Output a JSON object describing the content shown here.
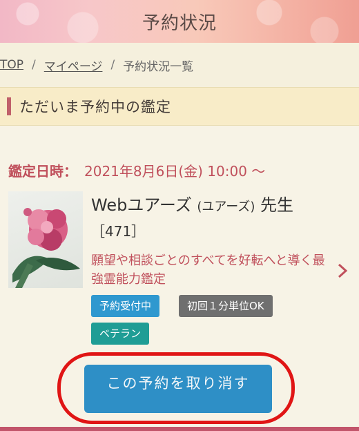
{
  "header": {
    "title": "予約状況"
  },
  "breadcrumb": {
    "items": [
      {
        "label": "TOP"
      },
      {
        "label": "マイページ"
      },
      {
        "label": "予約状況一覧"
      }
    ],
    "separator": "/"
  },
  "section": {
    "title": "ただいま予約中の鑑定"
  },
  "reservation": {
    "date_label": "鑑定日時：",
    "date_value": "2021年8月6日(金) 10:00 〜",
    "teller_name": "Webユアーズ",
    "teller_reading": "(ユアーズ)",
    "teller_suffix": "先生",
    "teller_id": "［471］",
    "description": "願望や相談ごとのすべてを好転へと導く最強霊能力鑑定",
    "tags": [
      {
        "label": "予約受付中",
        "color": "#2f98cf"
      },
      {
        "label": "初回１分単位OK",
        "color": "#6f6f6f"
      },
      {
        "label": "ベテラン",
        "color": "#1f9d95"
      }
    ],
    "cancel_label": "この予約を取り消す"
  },
  "colors": {
    "accent_red": "#c0505c",
    "button_blue": "#2e8fc6",
    "highlight_circle": "#e01515"
  }
}
